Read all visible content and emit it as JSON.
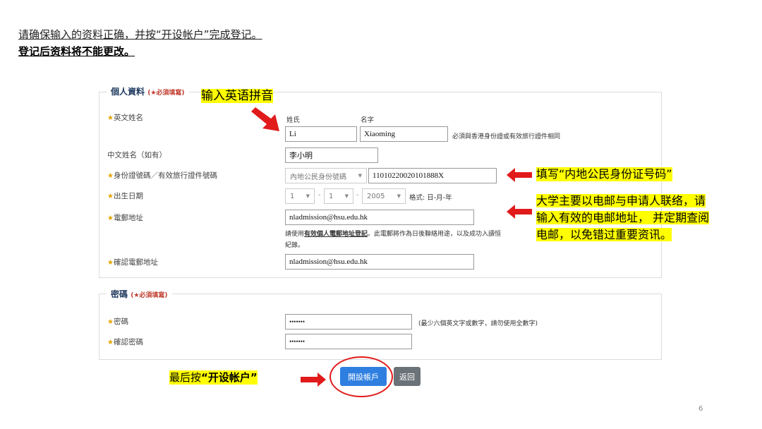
{
  "intro": {
    "line1": "请确保输入的资料正确，并按“开设帐户”完成登记。",
    "line2": "登记后资料将不能更改。"
  },
  "personal": {
    "legend": "個人資料",
    "required_note": "(★必須填寫)",
    "english_name": {
      "label": "英文姓名",
      "surname_label": "姓氏",
      "given_label": "名字",
      "surname_value": "Li",
      "given_value": "Xiaoming",
      "note": "必須與香港身份證或有效旅行證件相同"
    },
    "chinese_name": {
      "label": "中文姓名（如有）",
      "value": "李小明"
    },
    "id_number": {
      "label": "身份證號碼／有效旅行證件號碼",
      "type_value": "內地公民身份號碼",
      "value": "11010220020101888X"
    },
    "dob": {
      "label": "出生日期",
      "day": "1",
      "month": "1",
      "year": "2005",
      "format_hint": "格式: 日-月-年"
    },
    "email": {
      "label": "電郵地址",
      "value": "nladmission@hsu.edu.hk",
      "hint_prefix": "請使用",
      "hint_bold": "有效個人電郵地址登記",
      "hint_suffix": "。此電郵將作為日後聯絡用途，以及成功入讀恒",
      "hint_line2": "紀錄。"
    },
    "confirm_email": {
      "label": "確認電郵地址",
      "value": "nladmission@hsu.edu.hk"
    }
  },
  "password": {
    "legend": "密碼",
    "required_note": "(★必須填寫)",
    "password": {
      "label": "密碼",
      "value": "•••••••",
      "hint": "(最少六個英文字或數字，請勿使用全數字)"
    },
    "confirm": {
      "label": "確認密碼",
      "value": "•••••••"
    }
  },
  "buttons": {
    "open_account": "開設帳戶",
    "back": "返回"
  },
  "annotations": {
    "pinyin": "输入英语拼音",
    "id_tip": "填写“内地公民身份证号码”",
    "email_tip_l1": "大学主要以电邮与申请人联络，请",
    "email_tip_l2": "输入有效的电邮地址， 并定期查阅",
    "email_tip_l3": "电邮，以免错过重要资讯。",
    "final_prefix": "最后按",
    "final_bold": "“开设帐户”"
  },
  "page_number": "6",
  "colors": {
    "accent_red": "#e11b1b",
    "highlight": "#ffff00",
    "primary_button": "#2f7fe0",
    "star": "#e6a500"
  }
}
